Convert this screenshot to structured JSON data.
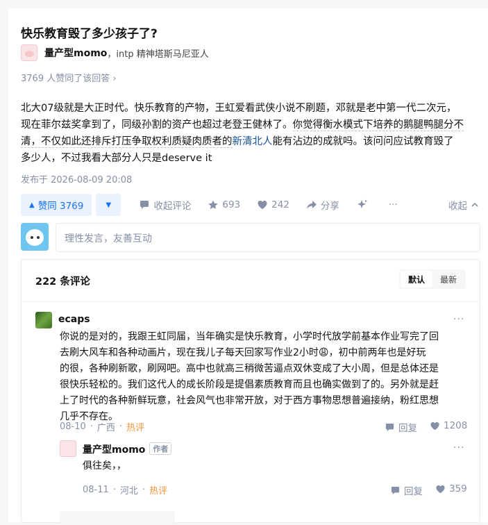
{
  "question": {
    "title": "快乐教育毁了多少孩子了?"
  },
  "author": {
    "name": "量产型momo",
    "bio": "，intp 精神塔斯马尼亚人"
  },
  "upvote_info": "3769 人赞同了该回答 ›",
  "answer": {
    "line1a": "北大07级就是大正时代",
    "line1b": "。快乐教育的产物，王虹爱看武侠小说不刷题，邓就是老中第一代二次元，",
    "line2": "现在菲尔兹奖拿到了，同级孙割的资产也超过老登王健林了。",
    "line2b": "你觉得衡水模式下培养的鹅腿鸭腿分不",
    "line3a": "清，不仅如此还排斥打压争取权利质疑肉质者的",
    "line3link": "新清北人",
    "line3b": "能有沾边的成就吗。该问问应试教育毁了",
    "line4": "多少人，不过我看大部分人只是deserve it",
    "published": "发布于 2026-08-09 20:08"
  },
  "actions": {
    "upvote": "赞同 3769",
    "comment": "收起评论",
    "collect": "693",
    "like": "242",
    "share": "分享",
    "more": "···",
    "collapse": "收起"
  },
  "comment_input": {
    "placeholder": "理性发言，友善互动"
  },
  "comments": {
    "count_label": "222 条评论",
    "sort": {
      "default": "默认",
      "latest": "最新"
    },
    "items": [
      {
        "user": "ecaps",
        "lines": [
          "你说的是对的，我跟王虹同届，当年确实是快乐教育，小学时代放学前基本作业写完了回",
          "去刷大风车和各种动画片，现在我儿子每天回家写作业2小时😩，初中前两年也是好玩",
          "的很，各种刷新歌，刷网吧。高中也就高三稍微苦逼点双休变成了大小周，但是总体还是",
          "很快乐轻松的。我们这代人的成长阶段是提倡素质教育而且也确实做到了的。另外就是赶",
          "上了时代的各种新鲜玩意，社会风气也非常开放，对于西方事物思想普遍接纳，粉红思想",
          "几乎不存在。"
        ],
        "date": "08-10",
        "location": "广西",
        "tag": "热评",
        "reply": "回复",
        "likes": "1208",
        "more": "···"
      },
      {
        "user": "量产型momo",
        "badge": "作者",
        "text": "俱往矣，，",
        "date": "08-11",
        "location": "河北",
        "tag": "热评",
        "reply": "回复",
        "likes": "359",
        "more": "···"
      }
    ]
  },
  "colors": {
    "accent": "#1772f6",
    "hot": "#f1953b",
    "muted": "#8590a6"
  }
}
